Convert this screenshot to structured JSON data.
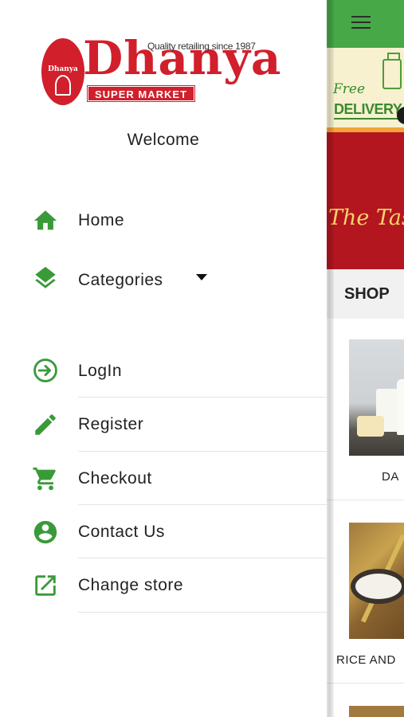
{
  "drawer": {
    "logo": {
      "brand": "Dhanya",
      "oval_text": "Dhanya",
      "tagline": "Quality retailing since 1987",
      "subtitle": "SUPER MARKET"
    },
    "welcome": "Welcome",
    "items": [
      {
        "label": "Home",
        "icon": "home-icon"
      },
      {
        "label": "Categories",
        "icon": "layers-icon"
      },
      {
        "label": "LogIn",
        "icon": "login-icon"
      },
      {
        "label": "Register",
        "icon": "pencil-icon"
      },
      {
        "label": "Checkout",
        "icon": "cart-icon"
      },
      {
        "label": "Contact Us",
        "icon": "account-icon"
      },
      {
        "label": "Change store",
        "icon": "open-external-icon"
      }
    ]
  },
  "app": {
    "promo": {
      "line1": "Free",
      "line2": "DELIVERY"
    },
    "banner_text": "The Taste",
    "shop_label": "SHOP",
    "cards": [
      {
        "caption": "DA"
      },
      {
        "caption": "RICE AND"
      }
    ]
  },
  "colors": {
    "accent_green": "#47a847",
    "icon_green": "#3a9a3a",
    "brand_red": "#d11f2b"
  }
}
